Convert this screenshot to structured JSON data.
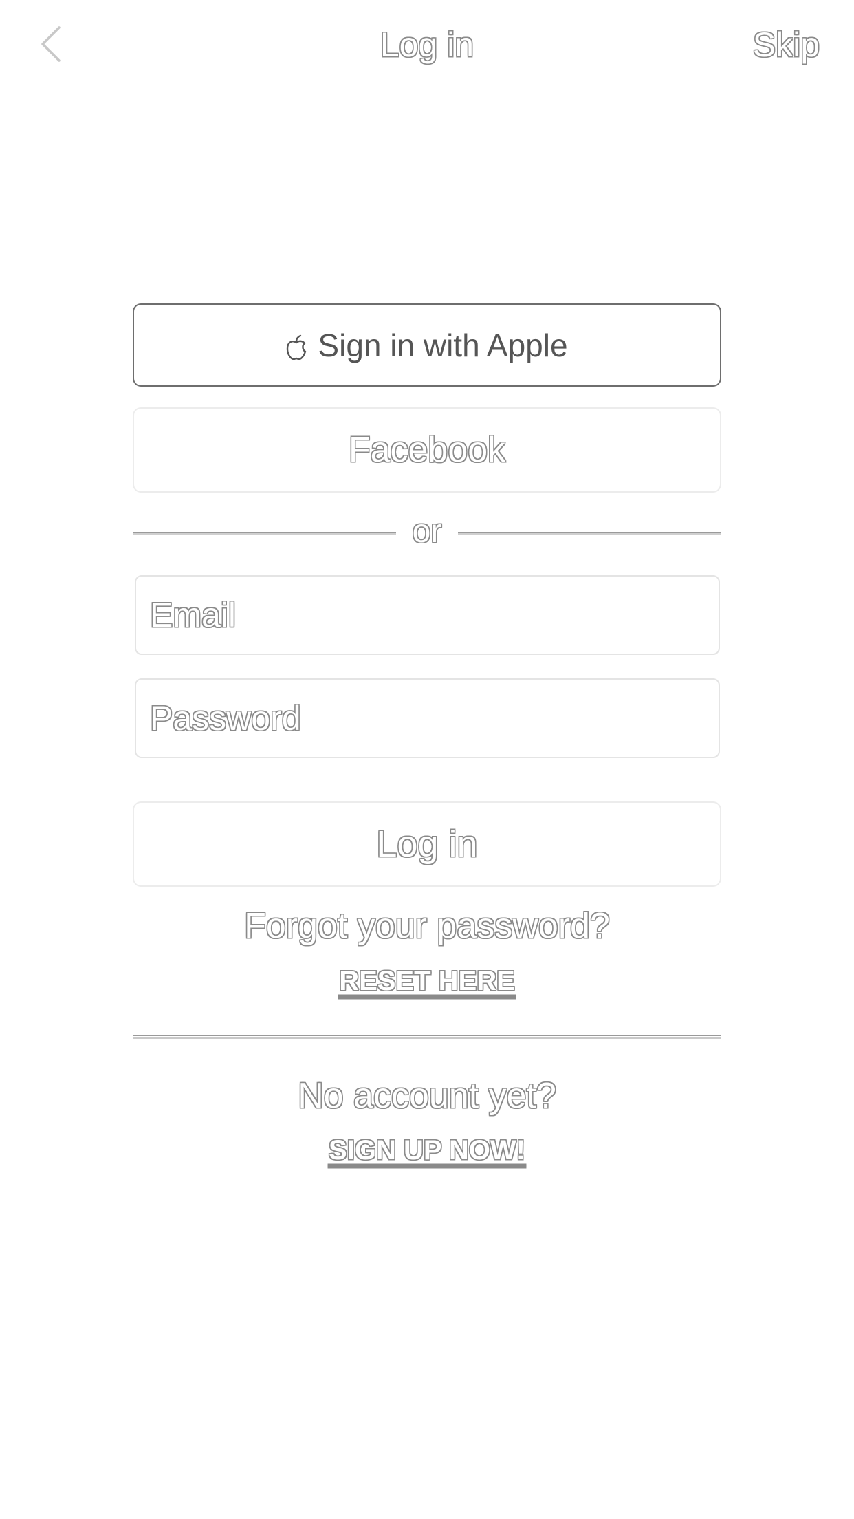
{
  "nav": {
    "back_icon": "chevron-left-icon",
    "title": "Log in",
    "skip_label": "Skip"
  },
  "social": {
    "apple_icon": "apple-logo-icon",
    "apple_label": "Sign in with Apple",
    "facebook_label": "Facebook"
  },
  "divider": {
    "label": "or"
  },
  "form": {
    "email": {
      "value": "",
      "placeholder": "Email"
    },
    "password": {
      "value": "",
      "placeholder": "Password"
    },
    "login_label": "Log in"
  },
  "forgot": {
    "prompt": "Forgot your password?",
    "link": "RESET HERE"
  },
  "signup": {
    "prompt": "No account yet?",
    "link": "SIGN UP NOW!"
  },
  "colors": {
    "background": "#ffffff",
    "outline_text": "#8a8a8a",
    "apple_border": "#6e6e6e",
    "apple_text": "#555555",
    "field_border": "#e4e4e4"
  }
}
